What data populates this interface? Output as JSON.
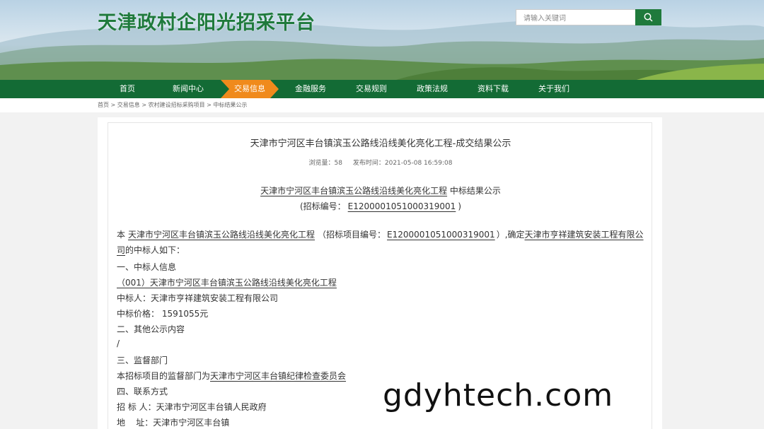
{
  "header": {
    "site_title": "天津政村企阳光招采平台",
    "search_placeholder": "请输入关键词"
  },
  "nav": {
    "items": [
      {
        "label": "首页"
      },
      {
        "label": "新闻中心"
      },
      {
        "label": "交易信息",
        "active": true
      },
      {
        "label": "金融服务"
      },
      {
        "label": "交易规则"
      },
      {
        "label": "政策法规"
      },
      {
        "label": "资料下载"
      },
      {
        "label": "关于我们"
      }
    ]
  },
  "breadcrumb": {
    "items": [
      "首页",
      "交易信息",
      "农村建设招标采购项目",
      "中标结果公示"
    ],
    "separator": " > "
  },
  "article": {
    "title": "天津市宁河区丰台镇滨玉公路线沿线美化亮化工程-成交结果公示",
    "views_label": "浏览量：",
    "views": "58",
    "published_label": "发布时间：",
    "published": "2021-05-08 16:59:08",
    "heading_project": "天津市宁河区丰台镇滨玉公路线沿线美化亮化工程",
    "heading_suffix": "中标结果公示",
    "bid_no_prefix": "(招标编号：",
    "bid_no": "E1200001051000319001",
    "bid_no_suffix": ")",
    "p1_a": "本",
    "p1_project": "天津市宁河区丰台镇滨玉公路线沿线美化亮化工程",
    "p1_b": "（招标项目编号：",
    "p1_no": "E1200001051000319001",
    "p1_c": "）,确定",
    "p1_company": "天津市亨祥建筑安装工程有限公司",
    "p1_d": "的中标人如下：",
    "s1": "一、中标人信息",
    "lot": "（001）天津市宁河区丰台镇滨玉公路线沿线美化亮化工程",
    "winner": "中标人：天津市亨祥建筑安装工程有限公司",
    "price": "中标价格：  1591055元",
    "s2": "二、其他公示内容",
    "s2_content": "/",
    "s3": "三、监督部门",
    "sup_a": "本招标项目的监督部门为",
    "sup_b": "天津市宁河区丰台镇纪律检查委员会",
    "s4": "四、联系方式",
    "tenderer": "招 标 人：天津市宁河区丰台镇人民政府",
    "address": "地    址：天津市宁河区丰台镇"
  },
  "watermark": "gdyhtech.com",
  "colors": {
    "brand_green": "#136b35",
    "title_green": "#1f7a3c",
    "active_orange": "#f08a1c"
  }
}
